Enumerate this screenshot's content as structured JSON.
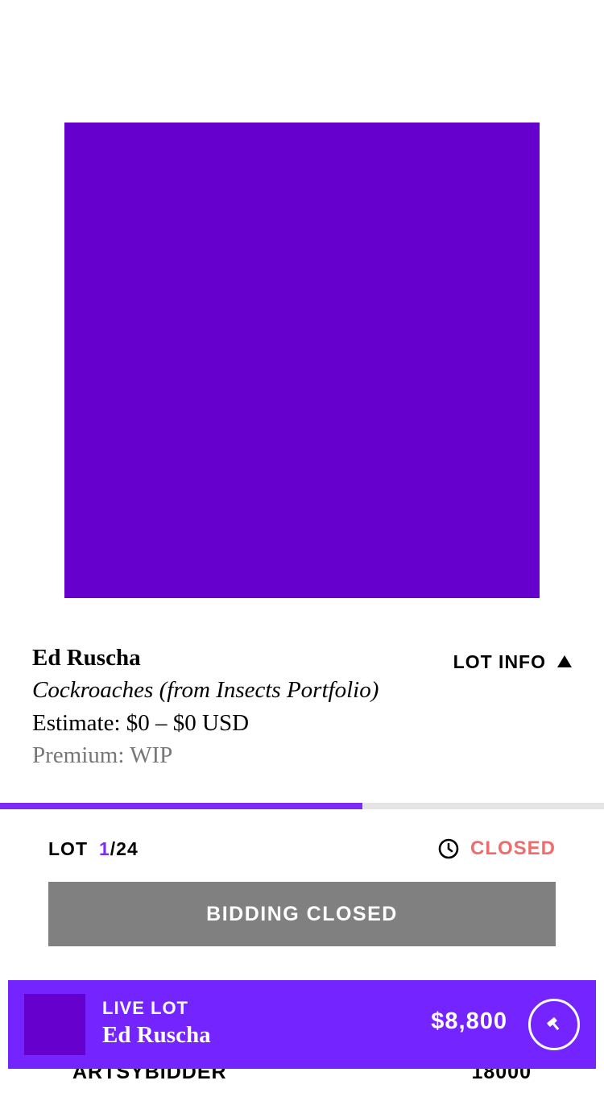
{
  "lot": {
    "artist": "Ed Ruscha",
    "title": "Cockroaches (from Insects Portfolio)",
    "estimate": "Estimate: $0 – $0 USD",
    "premium": "Premium: WIP",
    "info_label": "LOT INFO",
    "info_icon": "triangle-up-icon",
    "artwork_color": "#6600cc"
  },
  "progress": {
    "fraction": 0.6,
    "fill_color": "#7b2cf5"
  },
  "lot_counter": {
    "label": "LOT",
    "current": "1",
    "total": "/24"
  },
  "status": {
    "text": "CLOSED",
    "icon": "clock-icon",
    "color": "#f06b6b"
  },
  "bid_button": {
    "label": "BIDDING CLOSED"
  },
  "behind_row": {
    "name": "ARTSYBIDDER",
    "amount": "18000"
  },
  "live_bar": {
    "label": "LIVE LOT",
    "artist": "Ed Ruscha",
    "price": "$8,800",
    "icon": "gavel-icon",
    "bg_color": "#7425ff"
  }
}
